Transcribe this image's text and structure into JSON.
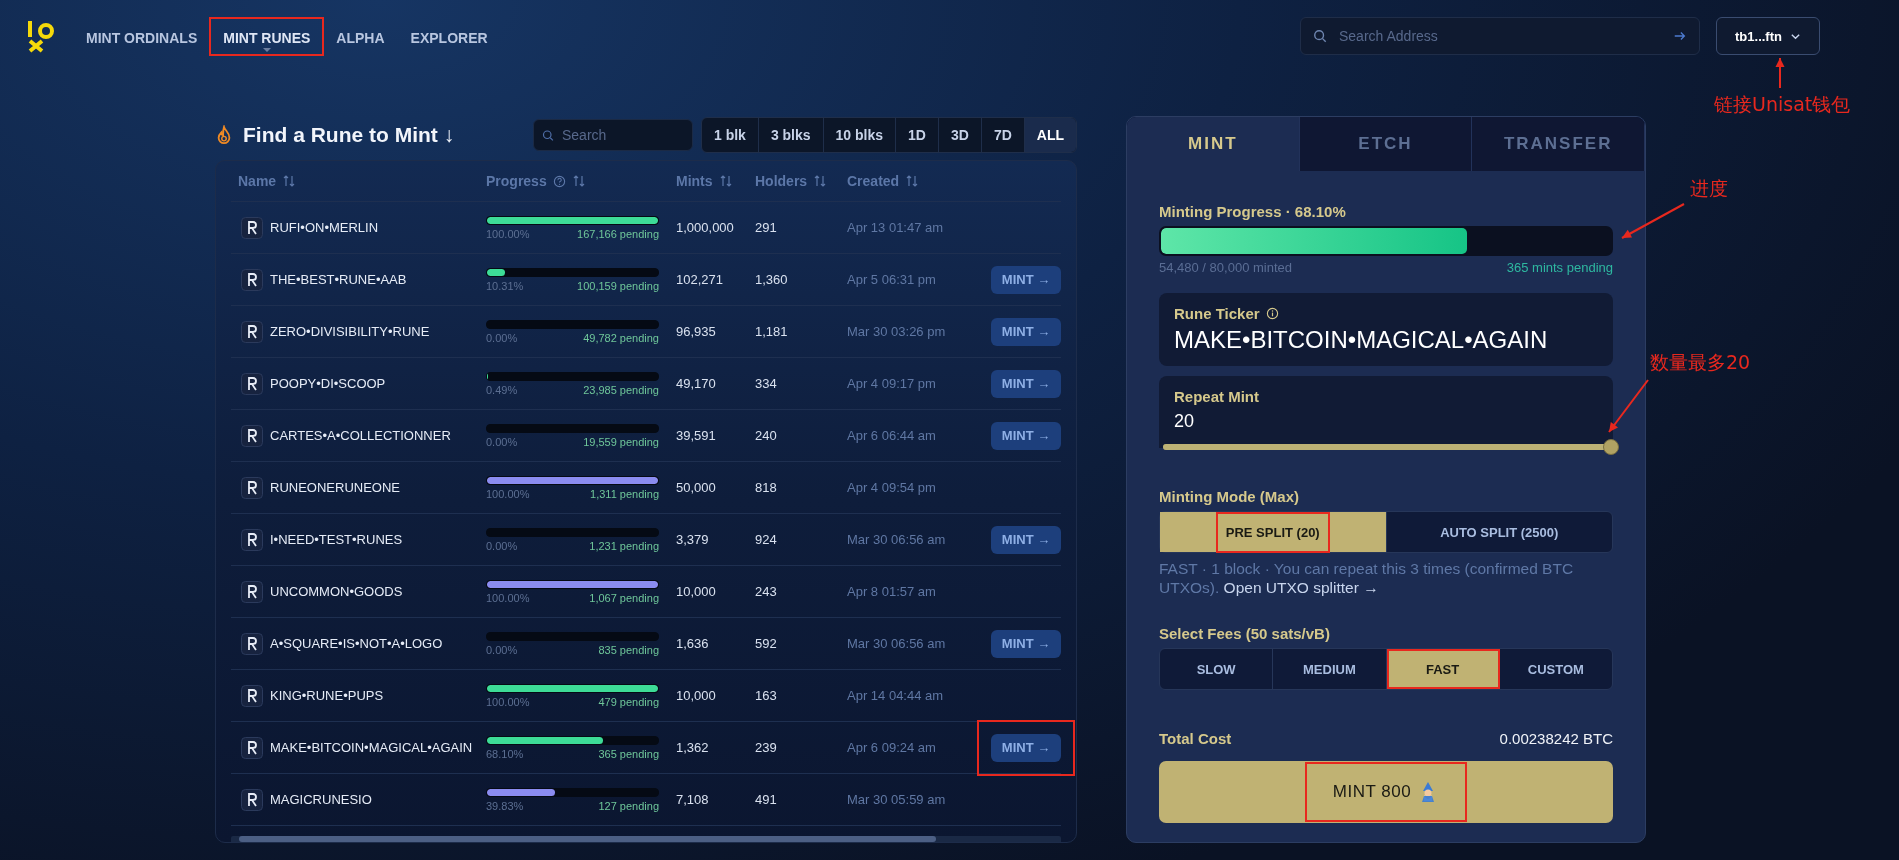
{
  "nav": {
    "items": [
      {
        "label": "MINT ORDINALS",
        "selected": false,
        "highlighted": false
      },
      {
        "label": "MINT RUNES",
        "selected": true,
        "highlighted": true
      },
      {
        "label": "ALPHA",
        "selected": false,
        "highlighted": false
      },
      {
        "label": "EXPLORER",
        "selected": false,
        "highlighted": false
      }
    ],
    "search": {
      "placeholder": "Search Address"
    },
    "wallet": {
      "label": "tb1...ftn"
    }
  },
  "finder": {
    "title": "Find a Rune to Mint ↓",
    "search": {
      "placeholder": "Search"
    },
    "filters": [
      {
        "label": "1 blk",
        "selected": false
      },
      {
        "label": "3 blks",
        "selected": false
      },
      {
        "label": "10 blks",
        "selected": false
      },
      {
        "label": "1D",
        "selected": false
      },
      {
        "label": "3D",
        "selected": false
      },
      {
        "label": "7D",
        "selected": false
      },
      {
        "label": "ALL",
        "selected": true
      }
    ],
    "table": {
      "columns": [
        "Name",
        "Progress",
        "Mints",
        "Holders",
        "Created"
      ],
      "rows": [
        {
          "name": "RUFI•ON•MERLIN",
          "level": 1,
          "percent": "100.00%",
          "pending": "167,166 pending",
          "color": "#3ddc97",
          "mints": "1,000,000",
          "holders": "291",
          "created": "Apr 13 01:47 am",
          "mint": null,
          "highlighted": false
        },
        {
          "name": "THE•BEST•RUNE•AAB",
          "level": 0.1031,
          "percent": "10.31%",
          "pending": "100,159 pending",
          "color": "#3ddc97",
          "mints": "102,271",
          "holders": "1,360",
          "created": "Apr 5 06:31 pm",
          "mint": "MINT →",
          "highlighted": false
        },
        {
          "name": "ZERO•DIVISIBILITY•RUNE",
          "level": 0,
          "percent": "0.00%",
          "pending": "49,782 pending",
          "mints": "96,935",
          "holders": "1,181",
          "created": "Mar 30 03:26 pm",
          "mint": "MINT →",
          "highlighted": false
        },
        {
          "name": "POOPY•DI•SCOOP",
          "level": 0.0049,
          "percent": "0.49%",
          "pending": "23,985 pending",
          "color": "#3ddc97",
          "mints": "49,170",
          "holders": "334",
          "created": "Apr 4 09:17 pm",
          "mint": "MINT →",
          "highlighted": false
        },
        {
          "name": "CARTES•A•COLLECTIONNER",
          "level": 0,
          "percent": "0.00%",
          "pending": "19,559 pending",
          "mints": "39,591",
          "holders": "240",
          "created": "Apr 6 06:44 am",
          "mint": "MINT →",
          "highlighted": false
        },
        {
          "name": "RUNEONERUNEONE",
          "level": 1,
          "percent": "100.00%",
          "pending": "1,311 pending",
          "color": "#8b8cf0",
          "mints": "50,000",
          "holders": "818",
          "created": "Apr 4 09:54 pm",
          "mint": null,
          "highlighted": false
        },
        {
          "name": "I•NEED•TEST•RUNES",
          "level": 0,
          "percent": "0.00%",
          "pending": "1,231 pending",
          "mints": "3,379",
          "holders": "924",
          "created": "Mar 30 06:56 am",
          "mint": "MINT →",
          "highlighted": false
        },
        {
          "name": "UNCOMMON•GOODS",
          "level": 1,
          "percent": "100.00%",
          "pending": "1,067 pending",
          "color": "#8b8cf0",
          "mints": "10,000",
          "holders": "243",
          "created": "Apr 8 01:57 am",
          "mint": null,
          "highlighted": false
        },
        {
          "name": "A•SQUARE•IS•NOT•A•LOGO",
          "level": 0,
          "percent": "0.00%",
          "pending": "835 pending",
          "mints": "1,636",
          "holders": "592",
          "created": "Mar 30 06:56 am",
          "mint": "MINT →",
          "highlighted": false
        },
        {
          "name": "KING•RUNE•PUPS",
          "level": 1,
          "percent": "100.00%",
          "pending": "479 pending",
          "color": "#3ddc97",
          "mints": "10,000",
          "holders": "163",
          "created": "Apr 14 04:44 am",
          "mint": null,
          "highlighted": false
        },
        {
          "name": "MAKE•BITCOIN•MAGICAL•AGAIN",
          "level": 0.681,
          "percent": "68.10%",
          "pending": "365 pending",
          "color": "#3ddc97",
          "mints": "1,362",
          "holders": "239",
          "created": "Apr 6 09:24 am",
          "mint": "MINT →",
          "highlighted": true
        },
        {
          "name": "MAGICRUNESIO",
          "level": 0.3983,
          "percent": "39.83%",
          "pending": "127 pending",
          "color": "#8b8cf0",
          "mints": "7,108",
          "holders": "491",
          "created": "Mar 30 05:59 am",
          "mint": null,
          "highlighted": false
        }
      ]
    }
  },
  "panel": {
    "tabs": [
      {
        "label": "MINT",
        "selected": true
      },
      {
        "label": "ETCH",
        "selected": false
      },
      {
        "label": "TRANSFER",
        "selected": false
      }
    ],
    "progress": {
      "label": "Minting Progress · 68.10%",
      "level": 0.681,
      "minted": "54,480 / 80,000 minted",
      "pending": "365 mints pending"
    },
    "ticker": {
      "label": "Rune Ticker",
      "value": "MAKE•BITCOIN•MAGICAL•AGAIN"
    },
    "repeat_mint": {
      "label": "Repeat Mint",
      "value": "20",
      "level": 1
    },
    "mode": {
      "label": "Minting Mode (Max)",
      "options": [
        {
          "label": "PRE SPLIT (20)",
          "selected": true,
          "highlighted": true
        },
        {
          "label": "AUTO SPLIT (2500)",
          "selected": false,
          "highlighted": false
        }
      ],
      "note": "FAST · 1 block · You can repeat this 3 times (confirmed BTC UTXOs).",
      "link": "Open UTXO splitter →"
    },
    "fees": {
      "label": "Select Fees (50 sats/vB)",
      "options": [
        {
          "label": "SLOW",
          "selected": false,
          "highlighted": false
        },
        {
          "label": "MEDIUM",
          "selected": false,
          "highlighted": false
        },
        {
          "label": "FAST",
          "selected": true,
          "highlighted": true
        },
        {
          "label": "CUSTOM",
          "selected": false,
          "highlighted": false
        }
      ]
    },
    "total": {
      "label": "Total Cost",
      "value": "0.00238242 BTC"
    },
    "mint_button": {
      "label": "MINT 800",
      "highlighted": true
    }
  },
  "annotations": [
    {
      "text": "链接Unisat钱包"
    },
    {
      "text": "进度"
    },
    {
      "text": "数量最多20"
    }
  ]
}
